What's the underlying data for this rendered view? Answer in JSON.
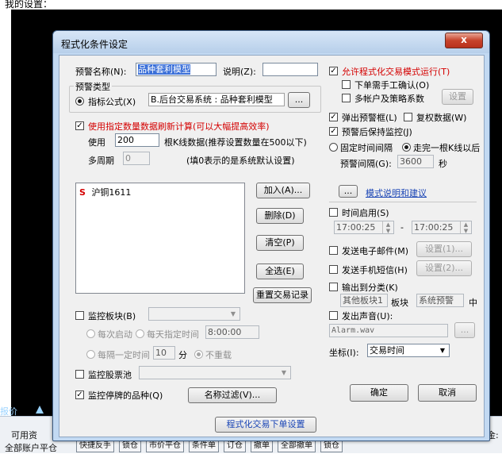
{
  "page": {
    "caption": "我的设置："
  },
  "background": {
    "left_labels": [
      "报价",
      "可用资",
      "全部账户平仓"
    ],
    "right_labels": [
      "金:"
    ],
    "bottom_buttons": [
      "快捷反手",
      "锁仓",
      "市价平仓",
      "条件单",
      "订仓",
      "撤单",
      "全部撤单",
      "锁仓"
    ]
  },
  "dialog": {
    "title": "程式化条件设定",
    "close_glyph": "x",
    "alert_name_label": "预警名称(N):",
    "alert_name_value": "品种套利模型",
    "desc_label": "说明(Z):",
    "desc_value": "",
    "alert_type_group": "预警类型",
    "indicator_formula_label": "指标公式(X)",
    "indicator_formula_value": "B.后台交易系统 : 品种套利模型",
    "browse_label": "...",
    "use_specified_label": "使用指定数量数据刷新计算(可以大幅提高效率)",
    "use_label": "使用",
    "use_value": "200",
    "use_suffix": "根K线数据(推荐设置数量在500以下)",
    "multi_period_label": "多周期",
    "multi_period_value": "0",
    "multi_period_hint": "(填0表示的是系统默认设置)",
    "list_items": [
      {
        "marker": "S",
        "name": "沪铜1611"
      }
    ],
    "add_button": "加入(A)...",
    "delete_button": "删除(D)",
    "clear_button": "清空(P)",
    "select_all_button": "全选(E)",
    "reset_button": "重置交易记录",
    "monitor_block_label": "监控板块(B)",
    "each_start_label": "每次启动",
    "daily_time_label": "每天指定时间",
    "daily_time_value": "8:00:00",
    "interval_label": "每隔一定时间",
    "interval_value": "10",
    "interval_unit": "分",
    "no_reload_label": "不重载",
    "monitor_pool_label": "监控股票池",
    "monitor_stopped_label": "监控停牌的品种(Q)",
    "name_filter_button": "名称过滤(V)...",
    "order_settings_button": "程式化交易下单设置",
    "allow_program_label": "允许程式化交易模式运行(T)",
    "manual_confirm_label": "下单需手工确认(O)",
    "multi_account_label": "多帐户及策略系数",
    "settings_button": "设置",
    "popup_label": "弹出预警框(L)",
    "reweight_label": "复权数据(W)",
    "keep_monitor_label": "预警后保持监控(J)",
    "fixed_interval_label": "固定时间间隔",
    "after_kline_label": "走完一根K线以后",
    "alert_interval_label": "预警间隔(G):",
    "alert_interval_value": "3600",
    "alert_interval_unit": "秒",
    "mode_button": "...",
    "mode_link": "模式说明和建议",
    "time_enable_label": "时间启用(S)",
    "time_from": "17:00:25",
    "time_sep": "-",
    "time_to": "17:00:25",
    "send_email_label": "发送电子邮件(M)",
    "email_settings_button": "设置(1)...",
    "send_sms_label": "发送手机短信(H)",
    "sms_settings_button": "设置(2)...",
    "output_category_label": "输出到分类(K)",
    "other_block_value": "其他板块1",
    "block_label": "板块",
    "system_alert_value": "系统预警",
    "mid_label": "中",
    "sound_label": "发出声音(U):",
    "sound_file": "Alarm.wav",
    "sound_browse": "...",
    "coordinate_label": "坐标(I):",
    "coordinate_value": "交易时间",
    "ok_button": "确定",
    "cancel_button": "取消",
    "check_glyph": "✓"
  }
}
